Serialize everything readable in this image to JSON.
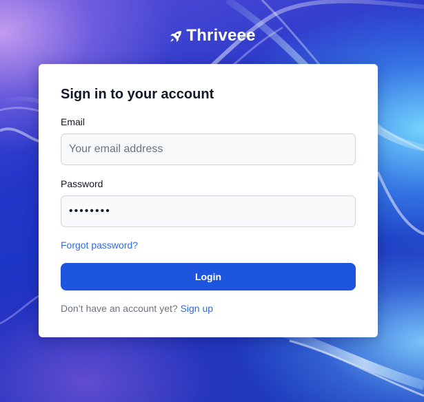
{
  "brand": {
    "name": "Thriveee",
    "icon": "rocket-icon"
  },
  "login_form": {
    "title": "Sign in to your account",
    "email_label": "Email",
    "email_placeholder": "Your email address",
    "email_value": "",
    "password_label": "Password",
    "password_value": "••••••••",
    "forgot_password": "Forgot password?",
    "login_button": "Login",
    "signup_prompt": "Don’t have an account yet?",
    "signup_link": "Sign up"
  },
  "colors": {
    "accent": "#1d55de",
    "link": "#2f6be0",
    "card": "#ffffff",
    "background": "#1a34c4"
  }
}
